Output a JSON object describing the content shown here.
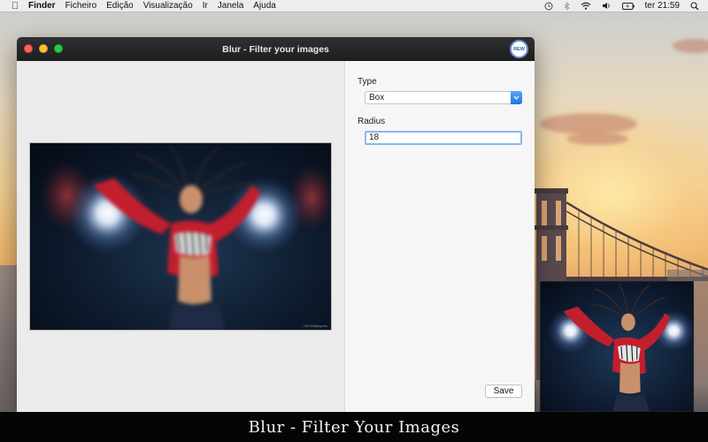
{
  "menubar": {
    "app_name": "Finder",
    "items": [
      "Ficheiro",
      "Edição",
      "Visualização",
      "Ir",
      "Janela",
      "Ajuda"
    ],
    "clock": "ter 21:59",
    "status_icons": [
      "time-machine-icon",
      "bluetooth-icon",
      "wifi-icon",
      "volume-icon",
      "battery-icon",
      "search-icon"
    ]
  },
  "window": {
    "title": "Blur - Filter your images",
    "badge": "REW"
  },
  "controls": {
    "type_label": "Type",
    "type_value": "Box",
    "radius_label": "Radius",
    "radius_value": "18",
    "save_label": "Save"
  },
  "preview": {
    "watermark": "HD Wallpapers"
  },
  "caption": "Blur - Filter Your Images",
  "colors": {
    "titlebar": "#1d1e20",
    "accent": "#1f72e6",
    "focus_ring": "#8db6ef",
    "caption_bg": "#050505"
  }
}
